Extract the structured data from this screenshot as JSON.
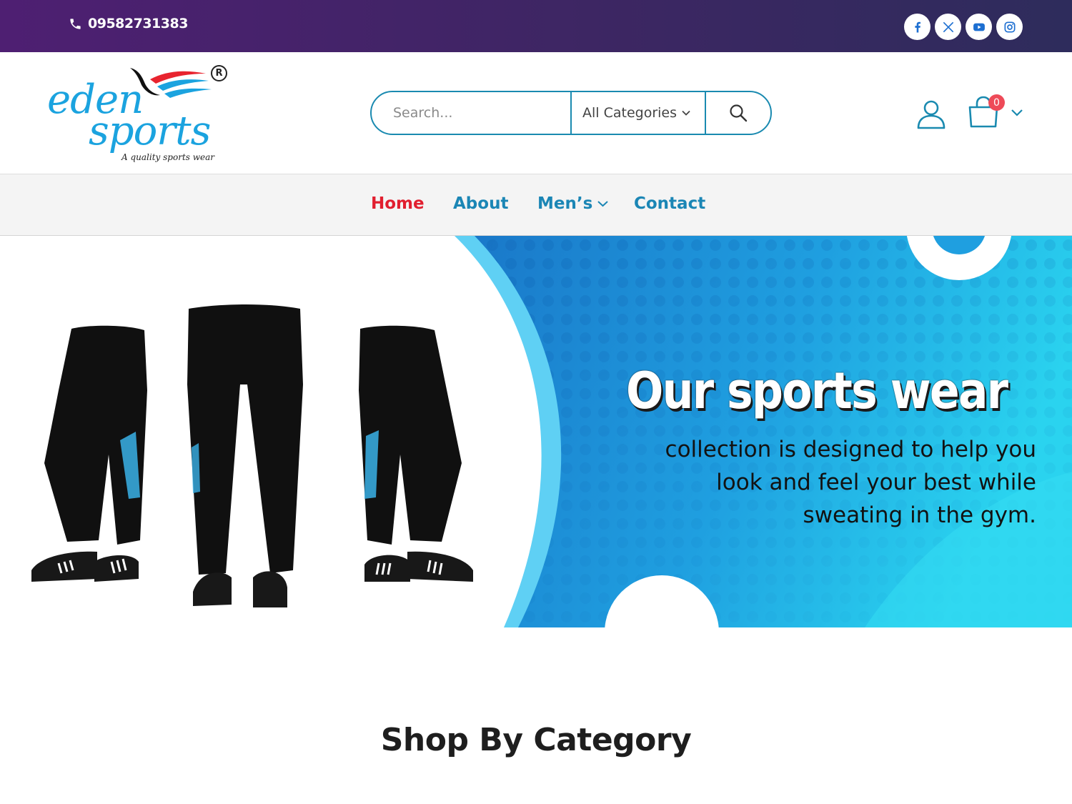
{
  "topbar": {
    "phone": "09582731383",
    "socials": [
      {
        "name": "facebook",
        "icon": "facebook-icon"
      },
      {
        "name": "x",
        "icon": "x-icon"
      },
      {
        "name": "youtube",
        "icon": "youtube-icon"
      },
      {
        "name": "instagram",
        "icon": "instagram-icon"
      }
    ],
    "colors": {
      "gradient_start": "#4e1f72",
      "gradient_end": "#2e2c5c"
    }
  },
  "header": {
    "logo": {
      "word1": "eden",
      "word2": "sports",
      "tagline": "A quality sports wear",
      "registered": "R"
    },
    "search": {
      "placeholder": "Search...",
      "category": "All Categories"
    },
    "cart": {
      "count": "0"
    },
    "accent": "#1a8ab0"
  },
  "nav": {
    "items": [
      {
        "label": "Home",
        "active": true
      },
      {
        "label": "About",
        "active": false
      },
      {
        "label": "Men’s",
        "active": false,
        "has_dropdown": true
      },
      {
        "label": "Contact",
        "active": false
      }
    ],
    "active_color": "#e11f2f",
    "link_color": "#1b86b5"
  },
  "hero": {
    "title": "Our sports wear",
    "line1": "collection is designed to help you",
    "line2": "look and feel your best while",
    "line3": "sweating in the gym."
  },
  "section": {
    "title": "Shop By Category"
  }
}
